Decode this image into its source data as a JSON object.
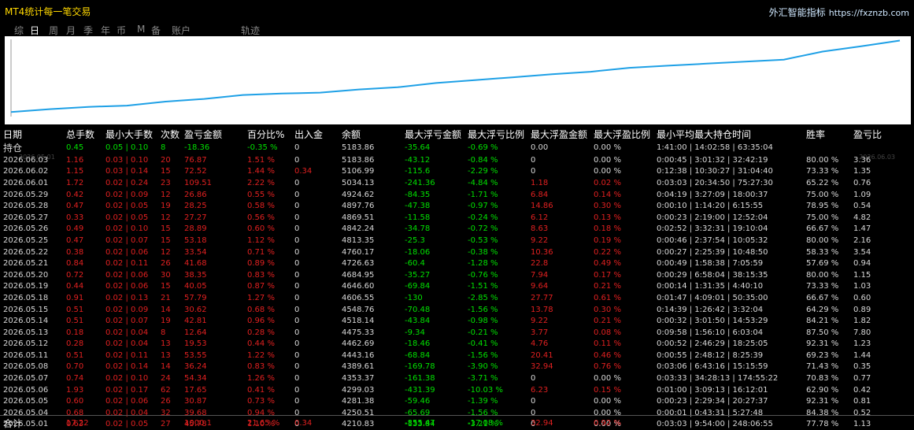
{
  "window": {
    "title": "MT4统计每一笔交易",
    "brand": "外汇智能指标",
    "url": "https://fxznzb.com"
  },
  "tabs": [
    "综",
    "日",
    "周",
    "月",
    "季",
    "年",
    "币",
    "M",
    "备",
    "账户",
    "轨迹"
  ],
  "active_tab": 1,
  "chart": {
    "start_label": "2026.05.01",
    "end_label": "2026.06.03",
    "line_color": "#1ea0e6",
    "values": [
      4210.83,
      4250.51,
      4281.38,
      4299.03,
      4353.37,
      4389.61,
      4443.16,
      4462.69,
      4475.33,
      4518.14,
      4548.76,
      4606.55,
      4646.6,
      4684.95,
      4726.63,
      4760.17,
      4813.35,
      4842.24,
      4869.51,
      4897.76,
      4924.62,
      5034.13,
      5106.99,
      5183.86
    ]
  },
  "table": {
    "headers": [
      "日期",
      "总手数",
      "最小大手数",
      "次数",
      "盈亏金额",
      "百分比%",
      "出入金",
      "余额",
      "最大浮亏金额",
      "最大浮亏比例",
      "最大浮盈金额",
      "最大浮盈比例",
      "最小平均最大持仓时间",
      "胜率",
      "盈亏比"
    ],
    "rows": [
      [
        "持仓",
        "0.45",
        "0.05 | 0.10",
        "8",
        "-18.36",
        "-0.35 %",
        "0",
        "5183.86",
        "-35.64",
        "-0.69 %",
        "0.00",
        "0.00 %",
        "1:41:00 | 14:02:58 | 63:35:04",
        "",
        ""
      ],
      [
        "2026.06.03",
        "1.16",
        "0.03 | 0.10",
        "20",
        "76.87",
        "1.51 %",
        "0",
        "5183.86",
        "-43.12",
        "-0.84 %",
        "0",
        "0.00 %",
        "0:00:45 | 3:01:32 | 32:42:19",
        "80.00 %",
        "3.36"
      ],
      [
        "2026.06.02",
        "1.15",
        "0.03 | 0.14",
        "15",
        "72.52",
        "1.44 %",
        "0.34",
        "5106.99",
        "-115.6",
        "-2.29 %",
        "0",
        "0.00 %",
        "0:12:38 | 10:30:27 | 31:04:40",
        "73.33 %",
        "1.35"
      ],
      [
        "2026.06.01",
        "1.72",
        "0.02 | 0.24",
        "23",
        "109.51",
        "2.22 %",
        "0",
        "5034.13",
        "-241.36",
        "-4.84 %",
        "1.18",
        "0.02 %",
        "0:03:03 | 20:34:50 | 75:27:30",
        "65.22 %",
        "0.76"
      ],
      [
        "2026.05.29",
        "0.42",
        "0.02 | 0.09",
        "12",
        "26.86",
        "0.55 %",
        "0",
        "4924.62",
        "-84.35",
        "-1.71 %",
        "6.84",
        "0.14 %",
        "0:04:19 | 3:27:09 | 18:00:37",
        "75.00 %",
        "1.09"
      ],
      [
        "2026.05.28",
        "0.47",
        "0.02 | 0.05",
        "19",
        "28.25",
        "0.58 %",
        "0",
        "4897.76",
        "-47.38",
        "-0.97 %",
        "14.86",
        "0.30 %",
        "0:00:10 | 1:14:20 | 6:15:55",
        "78.95 %",
        "0.54"
      ],
      [
        "2026.05.27",
        "0.33",
        "0.02 | 0.05",
        "12",
        "27.27",
        "0.56 %",
        "0",
        "4869.51",
        "-11.58",
        "-0.24 %",
        "6.12",
        "0.13 %",
        "0:00:23 | 2:19:00 | 12:52:04",
        "75.00 %",
        "4.82"
      ],
      [
        "2026.05.26",
        "0.49",
        "0.02 | 0.10",
        "15",
        "28.89",
        "0.60 %",
        "0",
        "4842.24",
        "-34.78",
        "-0.72 %",
        "8.63",
        "0.18 %",
        "0:02:52 | 3:32:31 | 19:10:04",
        "66.67 %",
        "1.47"
      ],
      [
        "2026.05.25",
        "0.47",
        "0.02 | 0.07",
        "15",
        "53.18",
        "1.12 %",
        "0",
        "4813.35",
        "-25.3",
        "-0.53 %",
        "9.22",
        "0.19 %",
        "0:00:46 | 2:37:54 | 10:05:32",
        "80.00 %",
        "2.16"
      ],
      [
        "2026.05.22",
        "0.38",
        "0.02 | 0.06",
        "12",
        "33.54",
        "0.71 %",
        "0",
        "4760.17",
        "-18.06",
        "-0.38 %",
        "10.36",
        "0.22 %",
        "0:00:27 | 2:25:39 | 10:48:50",
        "58.33 %",
        "3.54"
      ],
      [
        "2026.05.21",
        "0.84",
        "0.02 | 0.11",
        "26",
        "41.68",
        "0.89 %",
        "0",
        "4726.63",
        "-60.4",
        "-1.28 %",
        "22.8",
        "0.49 %",
        "0:00:49 | 1:58:38 | 7:05:59",
        "57.69 %",
        "0.94"
      ],
      [
        "2026.05.20",
        "0.72",
        "0.02 | 0.06",
        "30",
        "38.35",
        "0.83 %",
        "0",
        "4684.95",
        "-35.27",
        "-0.76 %",
        "7.94",
        "0.17 %",
        "0:00:29 | 6:58:04 | 38:15:35",
        "80.00 %",
        "1.15"
      ],
      [
        "2026.05.19",
        "0.44",
        "0.02 | 0.06",
        "15",
        "40.05",
        "0.87 %",
        "0",
        "4646.60",
        "-69.84",
        "-1.51 %",
        "9.64",
        "0.21 %",
        "0:00:14 | 1:31:35 | 4:40:10",
        "73.33 %",
        "1.03"
      ],
      [
        "2026.05.18",
        "0.91",
        "0.02 | 0.13",
        "21",
        "57.79",
        "1.27 %",
        "0",
        "4606.55",
        "-130",
        "-2.85 %",
        "27.77",
        "0.61 %",
        "0:01:47 | 4:09:01 | 50:35:00",
        "66.67 %",
        "0.60"
      ],
      [
        "2026.05.15",
        "0.51",
        "0.02 | 0.09",
        "14",
        "30.62",
        "0.68 %",
        "0",
        "4548.76",
        "-70.48",
        "-1.56 %",
        "13.78",
        "0.30 %",
        "0:14:39 | 1:26:42 | 3:32:04",
        "64.29 %",
        "0.89"
      ],
      [
        "2026.05.14",
        "0.51",
        "0.02 | 0.07",
        "19",
        "42.81",
        "0.96 %",
        "0",
        "4518.14",
        "-43.84",
        "-0.98 %",
        "9.22",
        "0.21 %",
        "0:00:32 | 3:01:50 | 14:53:29",
        "84.21 %",
        "1.82"
      ],
      [
        "2026.05.13",
        "0.18",
        "0.02 | 0.04",
        "8",
        "12.64",
        "0.28 %",
        "0",
        "4475.33",
        "-9.34",
        "-0.21 %",
        "3.77",
        "0.08 %",
        "0:09:58 | 1:56:10 | 6:03:04",
        "87.50 %",
        "7.80"
      ],
      [
        "2026.05.12",
        "0.28",
        "0.02 | 0.04",
        "13",
        "19.53",
        "0.44 %",
        "0",
        "4462.69",
        "-18.46",
        "-0.41 %",
        "4.76",
        "0.11 %",
        "0:00:52 | 2:46:29 | 18:25:05",
        "92.31 %",
        "1.23"
      ],
      [
        "2026.05.11",
        "0.51",
        "0.02 | 0.11",
        "13",
        "53.55",
        "1.22 %",
        "0",
        "4443.16",
        "-68.84",
        "-1.56 %",
        "20.41",
        "0.46 %",
        "0:00:55 | 2:48:12 | 8:25:39",
        "69.23 %",
        "1.44"
      ],
      [
        "2026.05.08",
        "0.70",
        "0.02 | 0.14",
        "14",
        "36.24",
        "0.83 %",
        "0",
        "4389.61",
        "-169.78",
        "-3.90 %",
        "32.94",
        "0.76 %",
        "0:03:06 | 6:43:16 | 15:15:59",
        "71.43 %",
        "0.35"
      ],
      [
        "2026.05.07",
        "0.74",
        "0.02 | 0.10",
        "24",
        "54.34",
        "1.26 %",
        "0",
        "4353.37",
        "-161.38",
        "-3.71 %",
        "0",
        "0.00 %",
        "0:03:33 | 34:28:13 | 174:55:22",
        "70.83 %",
        "0.77"
      ],
      [
        "2026.05.06",
        "1.93",
        "0.02 | 0.17",
        "62",
        "17.65",
        "0.41 %",
        "0",
        "4299.03",
        "-431.39",
        "-10.03 %",
        "6.23",
        "0.15 %",
        "0:01:00 | 3:09:13 | 16:12:01",
        "62.90 %",
        "0.42"
      ],
      [
        "2026.05.05",
        "0.60",
        "0.02 | 0.06",
        "26",
        "30.87",
        "0.73 %",
        "0",
        "4281.38",
        "-59.46",
        "-1.39 %",
        "0",
        "0.00 %",
        "0:00:23 | 2:29:34 | 20:27:37",
        "92.31 %",
        "0.81"
      ],
      [
        "2026.05.04",
        "0.68",
        "0.02 | 0.04",
        "32",
        "39.68",
        "0.94 %",
        "0",
        "4250.51",
        "-65.69",
        "-1.56 %",
        "0",
        "0.00 %",
        "0:00:01 | 0:43:31 | 5:27:48",
        "84.38 %",
        "0.52"
      ],
      [
        "2026.05.01",
        "0.63",
        "0.02 | 0.05",
        "27",
        "45.78",
        "1.10 %",
        "0",
        "4210.83",
        "-133.84",
        "-3.21 %",
        "0",
        "0.00 %",
        "0:03:03 | 9:54:00 | 248:06:55",
        "77.78 %",
        "1.13"
      ]
    ],
    "total": [
      "合计",
      "17.22",
      "",
      "",
      "1000.1",
      "21.65 %",
      "0.34",
      "",
      "-855.47",
      "-17.08 %",
      "32.94",
      "0.92 %",
      "",
      "",
      ""
    ]
  },
  "colors": {
    "profit": "#e02020",
    "loss": "#00e000",
    "neutral": "#d8d8d8"
  }
}
